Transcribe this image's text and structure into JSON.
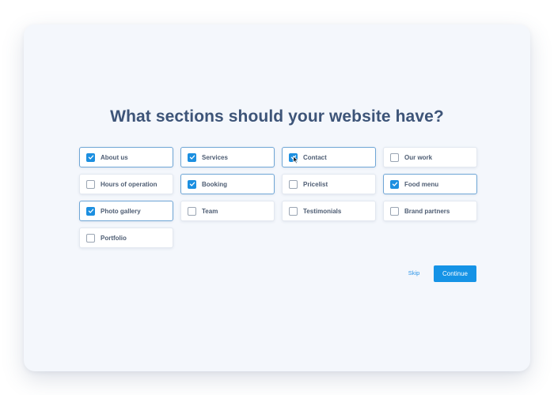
{
  "page": {
    "title": "What sections should your website have?"
  },
  "options": [
    {
      "label": "About us",
      "checked": true
    },
    {
      "label": "Services",
      "checked": true
    },
    {
      "label": "Contact",
      "checked": true
    },
    {
      "label": "Our work",
      "checked": false
    },
    {
      "label": "Hours of operation",
      "checked": false
    },
    {
      "label": "Booking",
      "checked": true
    },
    {
      "label": "Pricelist",
      "checked": false
    },
    {
      "label": "Food menu",
      "checked": true
    },
    {
      "label": "Photo gallery",
      "checked": true
    },
    {
      "label": "Team",
      "checked": false
    },
    {
      "label": "Testimonials",
      "checked": false
    },
    {
      "label": "Brand partners",
      "checked": false
    },
    {
      "label": "Portfolio",
      "checked": false
    }
  ],
  "actions": {
    "skip_label": "Skip",
    "continue_label": "Continue"
  },
  "colors": {
    "accent": "#1593e6",
    "title": "#3d5478",
    "panel_background": "#f4f7fc"
  },
  "icons": {
    "checkbox": "check-icon",
    "pointer": "mouse-cursor-icon"
  }
}
